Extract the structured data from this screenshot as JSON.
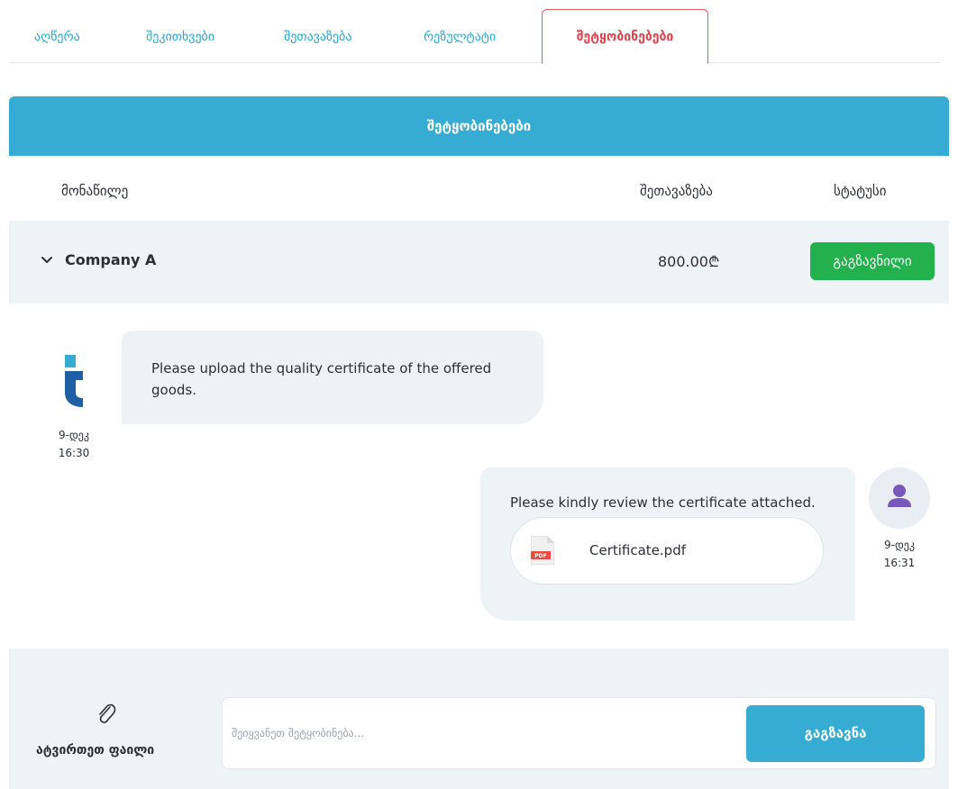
{
  "tabs": [
    {
      "label": "აღწერა"
    },
    {
      "label": "შეკითხვები"
    },
    {
      "label": "შეთავაზება"
    },
    {
      "label": "რეზულტატი"
    },
    {
      "label": "შეტყობინებები",
      "active": true
    }
  ],
  "panel": {
    "title": "შეტყობინებები",
    "columns": {
      "participant": "მონაწილე",
      "offer": "შეთავაზება",
      "status": "სტატუსი"
    },
    "row": {
      "company": "Company A",
      "amount": "800.00₾",
      "status": "გაგზავნილი"
    }
  },
  "messages": [
    {
      "side": "left",
      "text": "Please upload the quality certificate of the offered goods.",
      "date": "9-დეკ",
      "time": "16:30"
    },
    {
      "side": "right",
      "text": "Please kindly review the certificate attached.",
      "attachment": {
        "name": "Certificate.pdf",
        "badge": "PDF"
      },
      "date": "9-დეკ",
      "time": "16:31"
    }
  ],
  "composer": {
    "attach_label": "ატვირთეთ ფაილი",
    "placeholder": "შეიყვანეთ შეტყობინება...",
    "send_label": "გაგზავნა"
  },
  "colors": {
    "accent": "#36acd3",
    "active_tab": "#e2424d",
    "status_green": "#22b14c",
    "light_bg": "#eef3f6"
  },
  "icons": {
    "chevron": "chevron-down-icon",
    "logo": "tender-logo-icon",
    "pdf": "pdf-file-icon",
    "avatar": "user-avatar-icon",
    "attach": "paperclip-icon"
  }
}
